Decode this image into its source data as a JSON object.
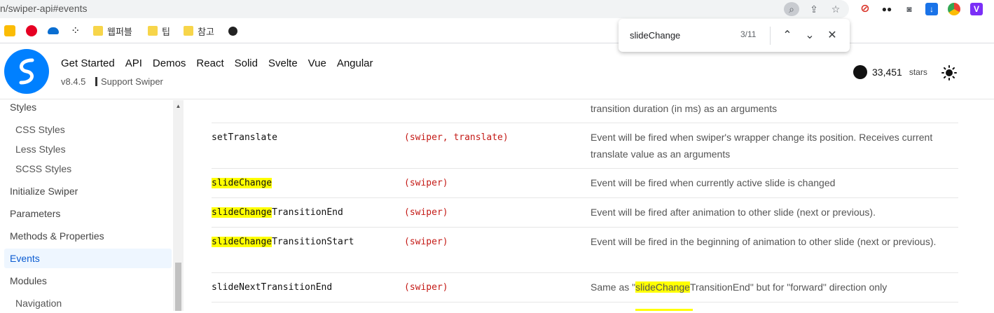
{
  "browser": {
    "url": "n/swiper-api#events",
    "bookmarks": [
      "웹퍼블",
      "팁",
      "참고"
    ]
  },
  "find": {
    "query": "slideChange",
    "count": "3/11"
  },
  "site": {
    "nav": [
      "Get Started",
      "API",
      "Demos",
      "React",
      "Solid",
      "Svelte",
      "Vue",
      "Angular"
    ],
    "version": "v8.4.5",
    "support": "Support Swiper",
    "github_count": "33,451",
    "github_stars": "stars"
  },
  "sidebar": {
    "items": [
      {
        "label": "Styles",
        "sub": false
      },
      {
        "label": "CSS Styles",
        "sub": true
      },
      {
        "label": "Less Styles",
        "sub": true
      },
      {
        "label": "SCSS Styles",
        "sub": true
      },
      {
        "label": "Initialize Swiper",
        "sub": false
      },
      {
        "label": "Parameters",
        "sub": false
      },
      {
        "label": "Methods & Properties",
        "sub": false
      },
      {
        "label": "Events",
        "sub": false,
        "active": true
      },
      {
        "label": "Modules",
        "sub": false
      },
      {
        "label": "Navigation",
        "sub": true
      }
    ]
  },
  "table": {
    "prev_desc": "transition duration (in ms) as an arguments",
    "rows": [
      {
        "hl": "",
        "event": "setTranslate",
        "args": "(swiper, translate)",
        "desc": "Event will be fired when swiper's wrapper change its position. Receives current translate value as an arguments"
      },
      {
        "hl": "slideChange",
        "event": "",
        "args": "(swiper)",
        "desc": "Event will be fired when currently active slide is changed"
      },
      {
        "hl": "slideChange",
        "event": "TransitionEnd",
        "args": "(swiper)",
        "desc": "Event will be fired after animation to other slide (next or previous)."
      },
      {
        "hl": "slideChange",
        "event": "TransitionStart",
        "args": "(swiper)",
        "desc": "Event will be fired in the beginning of animation to other slide (next or previous)."
      },
      {
        "hl": "",
        "event": "slideNextTransitionEnd",
        "args": "(swiper)",
        "desc_pre": "Same as \"",
        "desc_hl": "slideChange",
        "desc_post": "TransitionEnd\" but for \"forward\" direction only"
      }
    ]
  },
  "colors": {
    "accent": "#0080ff",
    "highlight": "#ffff00",
    "args": "#c41a16"
  }
}
